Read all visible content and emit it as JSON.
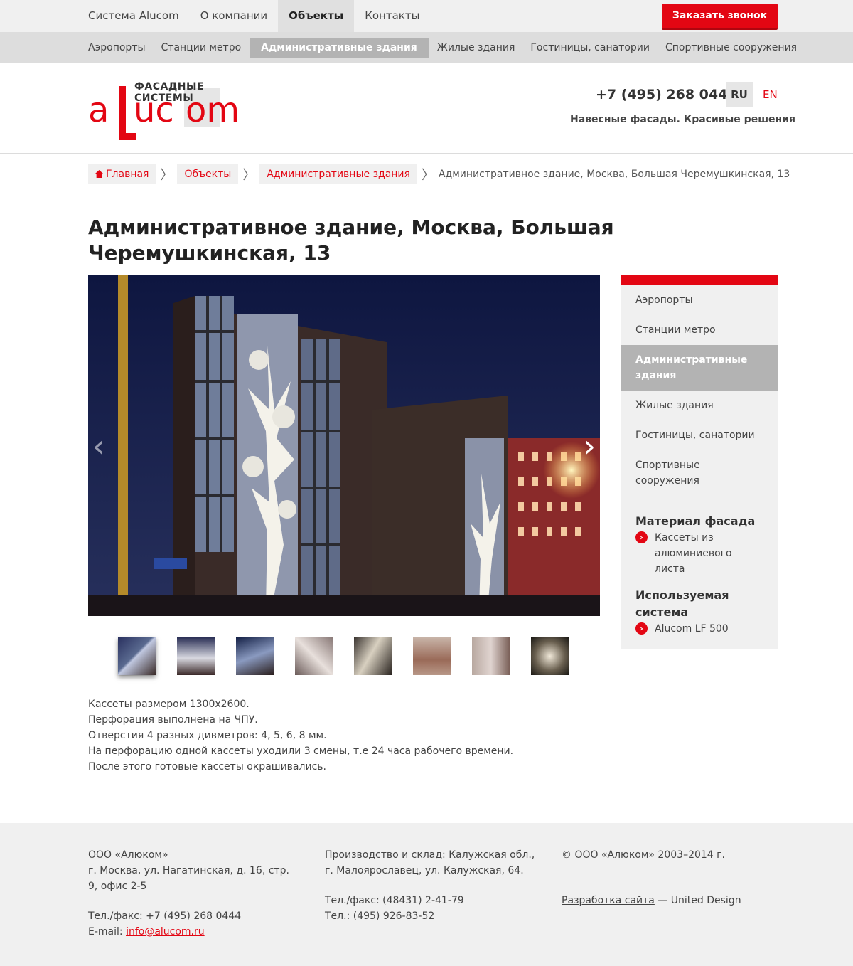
{
  "topnav": {
    "items": [
      "Система Alucom",
      "О компании",
      "Объекты",
      "Контакты"
    ],
    "active_index": 2,
    "callback_label": "Заказать звонок"
  },
  "subnav": {
    "items": [
      "Аэропорты",
      "Станции метро",
      "Административные здания",
      "Жилые здания",
      "Гостиницы, санатории",
      "Спортивные сооружения"
    ],
    "active_index": 2
  },
  "header": {
    "logo_tagline": "ФАСАДНЫЕ СИСТЕМЫ",
    "logo_name": "alucom",
    "phone": "+7 (495) 268 0444",
    "lang_ru": "RU",
    "lang_en": "EN",
    "slogan": "Навесные фасады. Красивые решения"
  },
  "breadcrumb": {
    "items": [
      "Главная",
      "Объекты",
      "Административные здания"
    ],
    "current": "Административное здание, Москва, Большая Черемушкинская, 13"
  },
  "page_title": "Административное здание, Москва, Большая Черемушкинская, 13",
  "gallery": {
    "prev": "‹",
    "next": "›",
    "thumb_count": 8,
    "active_thumb": 0
  },
  "description": [
    "Кассеты размером 1300х2600.",
    "Перфорация выполнена на ЧПУ.",
    "Отверстия 4 разных дивметров: 4, 5, 6, 8 мм.",
    "На перфорацию одной кассеты уходили 3 смены, т.е 24 часа рабочего времени.",
    "После этого готовые кассеты окрашивались."
  ],
  "sidebar": {
    "items": [
      "Аэропорты",
      "Станции метро",
      "Административные здания",
      "Жилые здания",
      "Гостиницы, санатории",
      "Спортивные сооружения"
    ],
    "active_index": 2
  },
  "info": {
    "material_title": "Материал фасада",
    "material_value": "Кассеты из алюминиевого листа",
    "system_title": "Используемая система",
    "system_value": "Alucom LF 500"
  },
  "footer": {
    "company": "ООО «Алюком»",
    "address": "г. Москва, ул. Нагатинская, д. 16, стр. 9, офис 2-5",
    "tel": "Тел./факс: +7 (495) 268 0444",
    "email_label": "E-mail: ",
    "email": "info@alucom.ru",
    "production": "Производство и склад: Калужская обл., г. Малоярославец, ул. Калужская, 64.",
    "prod_tel1": "Тел./факс: (48431) 2-41-79",
    "prod_tel2": "Тел.: (495) 926-83-52",
    "copyright": "© ООО «Алюком» 2003–2014 г.",
    "dev_link": "Разработка сайта",
    "dev_suffix": " — United Design"
  },
  "colors": {
    "accent": "#e30613",
    "gray_bg": "#f0f0f0",
    "active_gray": "#b3b3b3"
  }
}
